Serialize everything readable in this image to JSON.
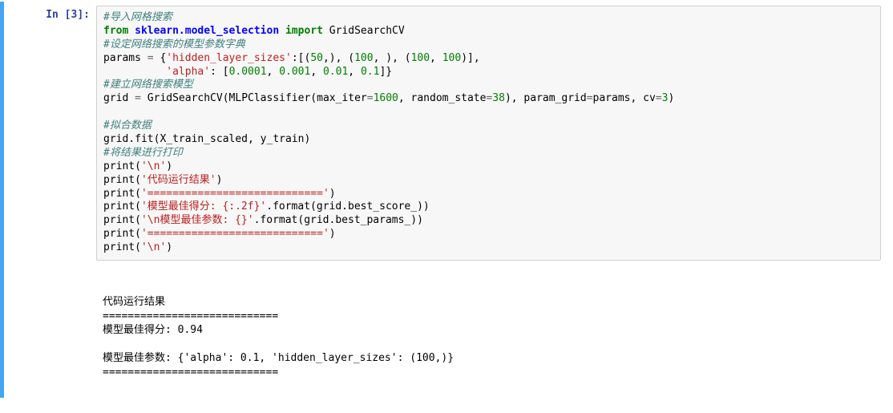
{
  "cell": {
    "prompt": "In [3]:"
  },
  "code": {
    "c01": "#导入网格搜索",
    "c02_a": "from ",
    "c02_b": "sklearn.model_selection",
    "c02_c": " import ",
    "c02_d": "GridSearchCV",
    "c03": "#设定网络搜索的模型参数字典",
    "c04_a": "params ",
    "c04_b": "=",
    "c04_c": " {",
    "c04_d": "'hidden_layer_sizes'",
    "c04_e": ":[(",
    "c04_f": "50",
    "c04_g": ",), (",
    "c04_h": "100",
    "c04_i": ", ), (",
    "c04_j": "100",
    "c04_k": ", ",
    "c04_l": "100",
    "c04_m": ")],",
    "c05_a": "          ",
    "c05_b": "'alpha'",
    "c05_c": ": [",
    "c05_d": "0.0001",
    "c05_e": ", ",
    "c05_f": "0.001",
    "c05_g": ", ",
    "c05_h": "0.01",
    "c05_i": ", ",
    "c05_j": "0.1",
    "c05_k": "]}",
    "c06": "#建立网络搜索模型",
    "c07_a": "grid ",
    "c07_b": "=",
    "c07_c": " GridSearchCV(MLPClassifier(max_iter",
    "c07_d": "=",
    "c07_e": "1600",
    "c07_f": ", random_state",
    "c07_g": "=",
    "c07_h": "38",
    "c07_i": "), param_grid",
    "c07_j": "=",
    "c07_k": "params, cv",
    "c07_l": "=",
    "c07_m": "3",
    "c07_n": ")",
    "c08": "",
    "c09": "#拟合数据",
    "c10": "grid.fit(X_train_scaled, y_train)",
    "c11": "#将结果进行打印",
    "c12_a": "print(",
    "c12_b": "'\\n'",
    "c12_c": ")",
    "c13_a": "print(",
    "c13_b": "'代码运行结果'",
    "c13_c": ")",
    "c14_a": "print(",
    "c14_b": "'============================'",
    "c14_c": ")",
    "c15_a": "print(",
    "c15_b": "'模型最佳得分: {:.2f}'",
    "c15_c": ".format(grid.best_score_))",
    "c16_a": "print(",
    "c16_b": "'\\n模型最佳参数: {}'",
    "c16_c": ".format(grid.best_params_))",
    "c17_a": "print(",
    "c17_b": "'============================'",
    "c17_c": ")",
    "c18_a": "print(",
    "c18_b": "'\\n'",
    "c18_c": ")"
  },
  "output": {
    "line1": "",
    "line2": "",
    "line3": "代码运行结果",
    "line4": "============================",
    "line5": "模型最佳得分: 0.94",
    "line6": "",
    "line7": "模型最佳参数: {'alpha': 0.1, 'hidden_layer_sizes': (100,)}",
    "line8": "============================",
    "line9": "",
    "line10": ""
  }
}
